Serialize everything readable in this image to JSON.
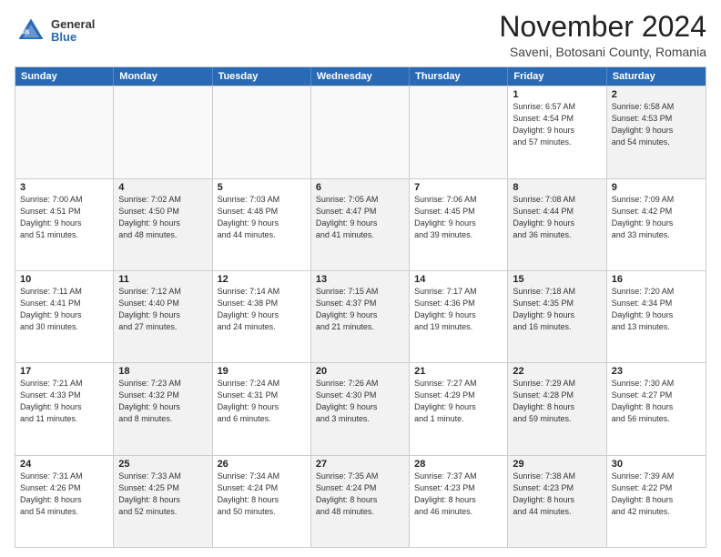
{
  "header": {
    "logo_general": "General",
    "logo_blue": "Blue",
    "title": "November 2024",
    "subtitle": "Saveni, Botosani County, Romania"
  },
  "calendar": {
    "days_of_week": [
      "Sunday",
      "Monday",
      "Tuesday",
      "Wednesday",
      "Thursday",
      "Friday",
      "Saturday"
    ],
    "weeks": [
      [
        {
          "day": "",
          "empty": true
        },
        {
          "day": "",
          "empty": true
        },
        {
          "day": "",
          "empty": true
        },
        {
          "day": "",
          "empty": true
        },
        {
          "day": "",
          "empty": true
        },
        {
          "day": "1",
          "info": "Sunrise: 6:57 AM\nSunset: 4:54 PM\nDaylight: 9 hours\nand 57 minutes.",
          "shaded": false
        },
        {
          "day": "2",
          "info": "Sunrise: 6:58 AM\nSunset: 4:53 PM\nDaylight: 9 hours\nand 54 minutes.",
          "shaded": true
        }
      ],
      [
        {
          "day": "3",
          "info": "Sunrise: 7:00 AM\nSunset: 4:51 PM\nDaylight: 9 hours\nand 51 minutes.",
          "shaded": false
        },
        {
          "day": "4",
          "info": "Sunrise: 7:02 AM\nSunset: 4:50 PM\nDaylight: 9 hours\nand 48 minutes.",
          "shaded": true
        },
        {
          "day": "5",
          "info": "Sunrise: 7:03 AM\nSunset: 4:48 PM\nDaylight: 9 hours\nand 44 minutes.",
          "shaded": false
        },
        {
          "day": "6",
          "info": "Sunrise: 7:05 AM\nSunset: 4:47 PM\nDaylight: 9 hours\nand 41 minutes.",
          "shaded": true
        },
        {
          "day": "7",
          "info": "Sunrise: 7:06 AM\nSunset: 4:45 PM\nDaylight: 9 hours\nand 39 minutes.",
          "shaded": false
        },
        {
          "day": "8",
          "info": "Sunrise: 7:08 AM\nSunset: 4:44 PM\nDaylight: 9 hours\nand 36 minutes.",
          "shaded": true
        },
        {
          "day": "9",
          "info": "Sunrise: 7:09 AM\nSunset: 4:42 PM\nDaylight: 9 hours\nand 33 minutes.",
          "shaded": false
        }
      ],
      [
        {
          "day": "10",
          "info": "Sunrise: 7:11 AM\nSunset: 4:41 PM\nDaylight: 9 hours\nand 30 minutes.",
          "shaded": false
        },
        {
          "day": "11",
          "info": "Sunrise: 7:12 AM\nSunset: 4:40 PM\nDaylight: 9 hours\nand 27 minutes.",
          "shaded": true
        },
        {
          "day": "12",
          "info": "Sunrise: 7:14 AM\nSunset: 4:38 PM\nDaylight: 9 hours\nand 24 minutes.",
          "shaded": false
        },
        {
          "day": "13",
          "info": "Sunrise: 7:15 AM\nSunset: 4:37 PM\nDaylight: 9 hours\nand 21 minutes.",
          "shaded": true
        },
        {
          "day": "14",
          "info": "Sunrise: 7:17 AM\nSunset: 4:36 PM\nDaylight: 9 hours\nand 19 minutes.",
          "shaded": false
        },
        {
          "day": "15",
          "info": "Sunrise: 7:18 AM\nSunset: 4:35 PM\nDaylight: 9 hours\nand 16 minutes.",
          "shaded": true
        },
        {
          "day": "16",
          "info": "Sunrise: 7:20 AM\nSunset: 4:34 PM\nDaylight: 9 hours\nand 13 minutes.",
          "shaded": false
        }
      ],
      [
        {
          "day": "17",
          "info": "Sunrise: 7:21 AM\nSunset: 4:33 PM\nDaylight: 9 hours\nand 11 minutes.",
          "shaded": false
        },
        {
          "day": "18",
          "info": "Sunrise: 7:23 AM\nSunset: 4:32 PM\nDaylight: 9 hours\nand 8 minutes.",
          "shaded": true
        },
        {
          "day": "19",
          "info": "Sunrise: 7:24 AM\nSunset: 4:31 PM\nDaylight: 9 hours\nand 6 minutes.",
          "shaded": false
        },
        {
          "day": "20",
          "info": "Sunrise: 7:26 AM\nSunset: 4:30 PM\nDaylight: 9 hours\nand 3 minutes.",
          "shaded": true
        },
        {
          "day": "21",
          "info": "Sunrise: 7:27 AM\nSunset: 4:29 PM\nDaylight: 9 hours\nand 1 minute.",
          "shaded": false
        },
        {
          "day": "22",
          "info": "Sunrise: 7:29 AM\nSunset: 4:28 PM\nDaylight: 8 hours\nand 59 minutes.",
          "shaded": true
        },
        {
          "day": "23",
          "info": "Sunrise: 7:30 AM\nSunset: 4:27 PM\nDaylight: 8 hours\nand 56 minutes.",
          "shaded": false
        }
      ],
      [
        {
          "day": "24",
          "info": "Sunrise: 7:31 AM\nSunset: 4:26 PM\nDaylight: 8 hours\nand 54 minutes.",
          "shaded": false
        },
        {
          "day": "25",
          "info": "Sunrise: 7:33 AM\nSunset: 4:25 PM\nDaylight: 8 hours\nand 52 minutes.",
          "shaded": true
        },
        {
          "day": "26",
          "info": "Sunrise: 7:34 AM\nSunset: 4:24 PM\nDaylight: 8 hours\nand 50 minutes.",
          "shaded": false
        },
        {
          "day": "27",
          "info": "Sunrise: 7:35 AM\nSunset: 4:24 PM\nDaylight: 8 hours\nand 48 minutes.",
          "shaded": true
        },
        {
          "day": "28",
          "info": "Sunrise: 7:37 AM\nSunset: 4:23 PM\nDaylight: 8 hours\nand 46 minutes.",
          "shaded": false
        },
        {
          "day": "29",
          "info": "Sunrise: 7:38 AM\nSunset: 4:23 PM\nDaylight: 8 hours\nand 44 minutes.",
          "shaded": true
        },
        {
          "day": "30",
          "info": "Sunrise: 7:39 AM\nSunset: 4:22 PM\nDaylight: 8 hours\nand 42 minutes.",
          "shaded": false
        }
      ]
    ]
  }
}
